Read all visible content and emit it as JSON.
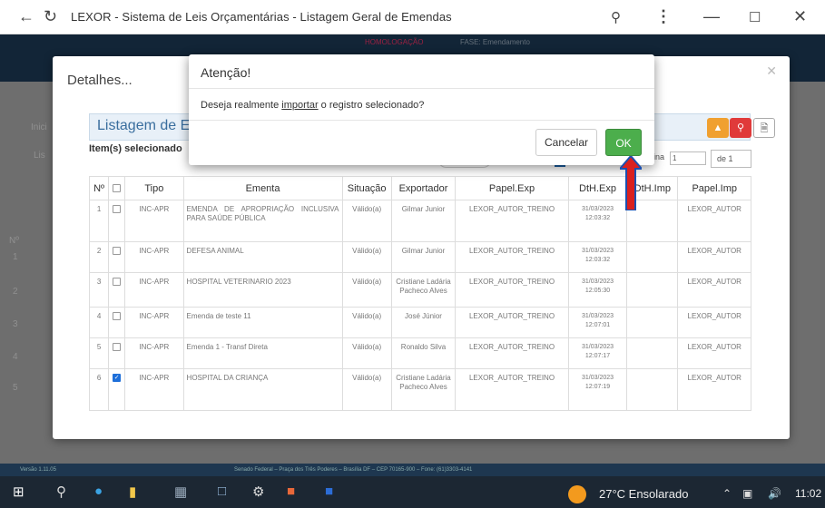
{
  "browser": {
    "title": "LEXOR - Sistema de Leis Orçamentárias - Listagem Geral de Emendas"
  },
  "app": {
    "header_badge_1": "HOMOLOGAÇÃO",
    "header_badge_2": "FASE: Emendamento",
    "footer_left": "Versão 1.11.05",
    "footer_center": "Senado Federal – Praça dos Três Poderes – Brasília DF – CEP 70165-900 – Fone: (61)3303-4141",
    "side_numbers": [
      "1",
      "2",
      "3",
      "4",
      "5"
    ],
    "side_header": "Nº",
    "left_labels": [
      "Inici",
      "Lis"
    ]
  },
  "details": {
    "title": "Detalhes...",
    "panel_title": "Listagem de E",
    "items_selected": "Item(s) selecionado",
    "pager_label": "ágina",
    "pager_value": "1",
    "pager_total": "de 1",
    "columns": [
      "Nº",
      "",
      "Tipo",
      "Ementa",
      "Situação",
      "Exportador",
      "Papel.Exp",
      "DtH.Exp",
      "DtH.Imp",
      "Papel.Imp"
    ],
    "rows": [
      {
        "n": "1",
        "checked": false,
        "tipo": "INC-APR",
        "ementa": "EMENDA DE APROPRIAÇÃO INCLUSIVA PARA SAÚDE PÚBLICA",
        "situacao": "Válido(a)",
        "exportador": "Gilmar Junior",
        "papel_exp": "LEXOR_AUTOR_TREINO",
        "dth_exp": "31/03/2023 12:03:32",
        "dth_imp": "",
        "papel_imp": "LEXOR_AUTOR"
      },
      {
        "n": "2",
        "checked": false,
        "tipo": "INC-APR",
        "ementa": "DEFESA ANIMAL",
        "situacao": "Válido(a)",
        "exportador": "Gilmar Junior",
        "papel_exp": "LEXOR_AUTOR_TREINO",
        "dth_exp": "31/03/2023 12:03:32",
        "dth_imp": "",
        "papel_imp": "LEXOR_AUTOR"
      },
      {
        "n": "3",
        "checked": false,
        "tipo": "INC-APR",
        "ementa": "HOSPITAL VETERINARIO 2023",
        "situacao": "Válido(a)",
        "exportador": "Cristiane Ladária Pacheco Alves",
        "papel_exp": "LEXOR_AUTOR_TREINO",
        "dth_exp": "31/03/2023 12:05:30",
        "dth_imp": "",
        "papel_imp": "LEXOR_AUTOR"
      },
      {
        "n": "4",
        "checked": false,
        "tipo": "INC-APR",
        "ementa": "Emenda de teste 11",
        "situacao": "Válido(a)",
        "exportador": "José Júnior",
        "papel_exp": "LEXOR_AUTOR_TREINO",
        "dth_exp": "31/03/2023 12:07:01",
        "dth_imp": "",
        "papel_imp": "LEXOR_AUTOR"
      },
      {
        "n": "5",
        "checked": false,
        "tipo": "INC-APR",
        "ementa": "Emenda 1 - Transf Direta",
        "situacao": "Válido(a)",
        "exportador": "Ronaldo Silva",
        "papel_exp": "LEXOR_AUTOR_TREINO",
        "dth_exp": "31/03/2023 12:07:17",
        "dth_imp": "",
        "papel_imp": "LEXOR_AUTOR"
      },
      {
        "n": "6",
        "checked": true,
        "tipo": "INC-APR",
        "ementa": "HOSPITAL DA CRIANÇA",
        "situacao": "Válido(a)",
        "exportador": "Cristiane Ladária Pacheco Alves",
        "papel_exp": "LEXOR_AUTOR_TREINO",
        "dth_exp": "31/03/2023 12:07:19",
        "dth_imp": "",
        "papel_imp": "LEXOR_AUTOR"
      }
    ]
  },
  "modal": {
    "title": "Atenção!",
    "message_before": "Deseja realmente ",
    "message_link": "importar",
    "message_after": " o registro selecionado?",
    "cancel_label": "Cancelar",
    "ok_label": "OK"
  },
  "taskbar": {
    "weather": "27°C  Ensolarado",
    "clock": "11:02"
  },
  "colors": {
    "ok_green": "#4cae4c",
    "arrow_red": "#d9201f",
    "arrow_blue": "#1b4fb0",
    "header_navy": "#1d3a55"
  }
}
